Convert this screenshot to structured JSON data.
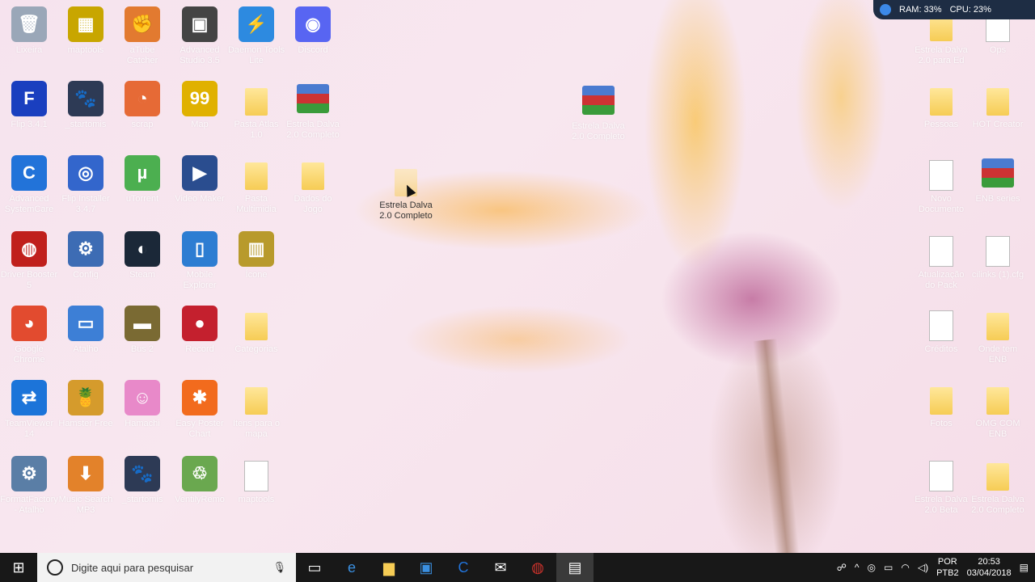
{
  "desktop": {
    "icons": [
      {
        "label": "Lixeira",
        "glyph": "🗑",
        "color": "#9aa7b8"
      },
      {
        "label": "maptools",
        "glyph": "▦",
        "color": "#c8a600"
      },
      {
        "label": "aTube Catcher",
        "glyph": "✊",
        "color": "#e27a30"
      },
      {
        "label": "Advanced Studio 3.5",
        "glyph": "▣",
        "color": "#444"
      },
      {
        "label": "Daemon Tools Lite",
        "glyph": "⚡",
        "color": "#2d8ae0"
      },
      {
        "label": "Discord",
        "glyph": "◉",
        "color": "#5865f2"
      },
      {
        "label": "Flip 3.4.1",
        "glyph": "F",
        "color": "#1a3fbf"
      },
      {
        "label": "_startomis",
        "glyph": "🐾",
        "color": "#2d3a55"
      },
      {
        "label": "scrap",
        "glyph": "◔",
        "color": "#e66a36"
      },
      {
        "label": "Map",
        "glyph": "99",
        "color": "#e0b100"
      },
      {
        "label": "Pasta Atlas 1.0",
        "glyph": "",
        "color": "#f6cc55"
      },
      {
        "label": "Estrela Dalva 2.0 Completo",
        "glyph": "",
        "color": "#4a7bd0"
      },
      {
        "label": "Advanced SystemCare",
        "glyph": "C",
        "color": "#2273d9"
      },
      {
        "label": "Flip Installer 3.4.7",
        "glyph": "◎",
        "color": "#3366cc"
      },
      {
        "label": "uTorrent",
        "glyph": "µ",
        "color": "#4caf50"
      },
      {
        "label": "Video Maker",
        "glyph": "▶",
        "color": "#2a4d8f"
      },
      {
        "label": "Pasta Multimidia",
        "glyph": "",
        "color": "#f6cc55"
      },
      {
        "label": "Dados do Jogo",
        "glyph": "",
        "color": "#f6cc55"
      },
      {
        "label": "Driver Booster 5",
        "glyph": "◍",
        "color": "#c0201c"
      },
      {
        "label": "Config",
        "glyph": "⚙",
        "color": "#3d6cb4"
      },
      {
        "label": "Steam",
        "glyph": "◐",
        "color": "#1b2838"
      },
      {
        "label": "Mobile Explorer",
        "glyph": "▯",
        "color": "#2d7dd2"
      },
      {
        "label": "Ícone",
        "glyph": "▥",
        "color": "#b89a2c"
      },
      {
        "label": "Google Chrome",
        "glyph": "◕",
        "color": "#e24b2f"
      },
      {
        "label": "Atalho",
        "glyph": "▭",
        "color": "#3d7fd6"
      },
      {
        "label": "Bus 2",
        "glyph": "▬",
        "color": "#7a6a33"
      },
      {
        "label": "Record",
        "glyph": "●",
        "color": "#c4202e"
      },
      {
        "label": "Categorias",
        "glyph": "",
        "color": "#f6cc55"
      },
      {
        "label": "TeamViewer 14",
        "glyph": "⇄",
        "color": "#1c74d9"
      },
      {
        "label": "Hamster Free",
        "glyph": "🍍",
        "color": "#d59b2c"
      },
      {
        "label": "Hamachi",
        "glyph": "☺",
        "color": "#e889c9"
      },
      {
        "label": "Easy Poster Chart",
        "glyph": "✱",
        "color": "#f26b1d"
      },
      {
        "label": "Itens para o mapa",
        "glyph": "",
        "color": "#f6cc55"
      },
      {
        "label": "FormatFactory - Atalho",
        "glyph": "⚙",
        "color": "#5a7ea6"
      },
      {
        "label": "Music Search MP3",
        "glyph": "⬇",
        "color": "#e3822a"
      },
      {
        "label": "_startomis",
        "glyph": "🐾",
        "color": "#2d3a55"
      },
      {
        "label": "VentilyRemo",
        "glyph": "♲",
        "color": "#6aa84f"
      },
      {
        "label": "maptools",
        "glyph": "",
        "color": "#ffffff"
      }
    ],
    "right_icons": [
      {
        "label": "Estrela Dalva 2.0 para Ed",
        "type": "folder"
      },
      {
        "label": "Ops",
        "type": "doc"
      },
      {
        "label": "Pessoas",
        "type": "folder"
      },
      {
        "label": "HOT Creator",
        "type": "folder"
      },
      {
        "label": "Novo Documento",
        "type": "doc"
      },
      {
        "label": "ENB series",
        "type": "rar"
      },
      {
        "label": "Atualização do Pack",
        "type": "doc"
      },
      {
        "label": "cilinks (1).cfg",
        "type": "doc"
      },
      {
        "label": "Créditos",
        "type": "doc"
      },
      {
        "label": "Onde tem ENB",
        "type": "folder"
      },
      {
        "label": "Fotos",
        "type": "folder"
      },
      {
        "label": "OMG COM ENB",
        "type": "folder"
      },
      {
        "label": "Estrela Dalva 2.0 Beta",
        "type": "doc"
      },
      {
        "label": "Estrela Dalva 2.0 Completo",
        "type": "folder"
      }
    ],
    "dragged_folder": {
      "label": "Estrela Dalva 2.0 Completo"
    },
    "center_rar": {
      "label": "Estrela Dalva 2.0 Completo"
    }
  },
  "perf": {
    "ram": "RAM: 33%",
    "cpu": "CPU: 23%"
  },
  "taskbar": {
    "search_placeholder": "Digite aqui para pesquisar",
    "lang_top": "POR",
    "lang_bottom": "PTB2",
    "time": "20:53",
    "date": "03/04/2018"
  }
}
